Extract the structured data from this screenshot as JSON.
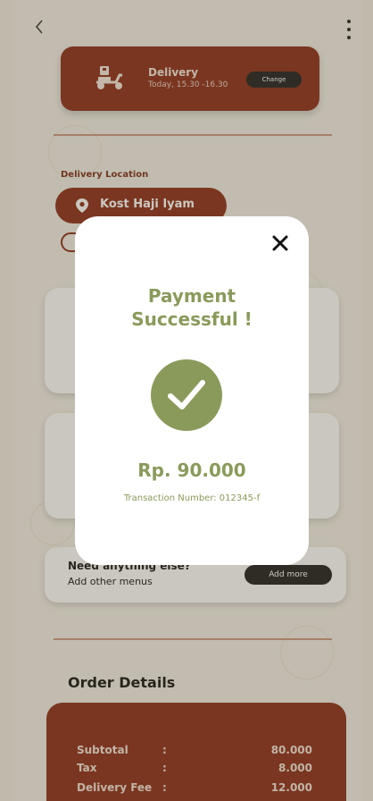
{
  "delivery": {
    "title": "Delivery",
    "time": "Today, 15.30 -16.30",
    "change_label": "Change"
  },
  "location": {
    "section_label": "Delivery Location",
    "name": "Kost Haji Iyam"
  },
  "need_more": {
    "title": "Need anything else?",
    "subtitle": "Add other menus",
    "button_label": "Add more"
  },
  "order": {
    "title": "Order Details",
    "rows": [
      {
        "label": "Subtotal",
        "colon": ":",
        "value": "80.000"
      },
      {
        "label": "Tax",
        "colon": ":",
        "value": "8.000"
      },
      {
        "label": "Delivery Fee",
        "colon": ":",
        "value": "12.000"
      }
    ]
  },
  "modal": {
    "title_line1": "Payment",
    "title_line2": "Successful !",
    "amount": "Rp. 90.000",
    "transaction": "Transaction Number: 012345-f"
  },
  "icons": {
    "back": "chevron-left-icon",
    "more": "more-vertical-icon",
    "delivery": "scooter-icon",
    "location": "location-pin-icon",
    "close": "close-icon",
    "check": "checkmark-icon"
  },
  "colors": {
    "brand": "#8a2a14",
    "success": "#8a9a5b",
    "background": "#f2efe6"
  }
}
